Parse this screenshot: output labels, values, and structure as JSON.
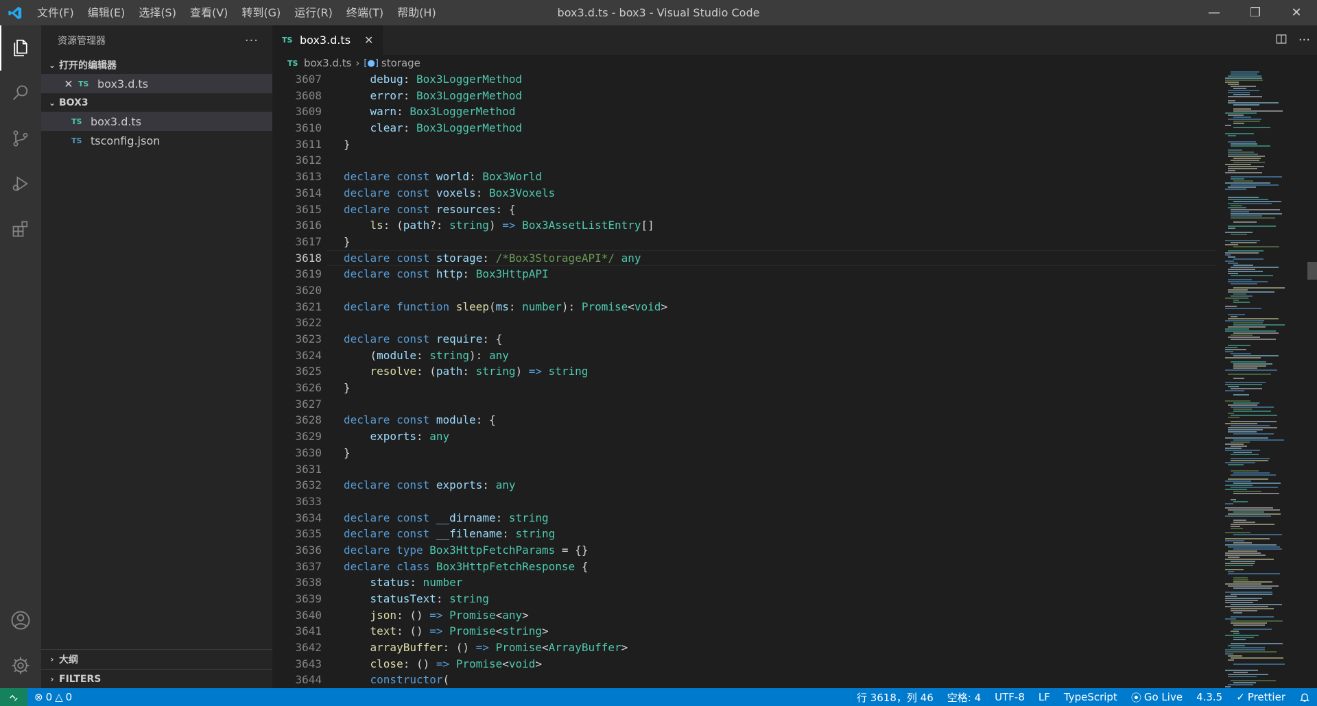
{
  "titlebar": {
    "title": "box3.d.ts - box3 - Visual Studio Code",
    "menu": [
      "文件(F)",
      "编辑(E)",
      "选择(S)",
      "查看(V)",
      "转到(G)",
      "运行(R)",
      "终端(T)",
      "帮助(H)"
    ],
    "controls": [
      "minimize-icon",
      "restore-icon",
      "close-icon"
    ]
  },
  "activitybar": {
    "items": [
      "explorer-icon",
      "search-icon",
      "source-control-icon",
      "run-debug-icon",
      "extensions-icon"
    ],
    "bottom": [
      "account-icon",
      "settings-gear-icon"
    ]
  },
  "sidebar": {
    "header": "资源管理器",
    "more": "···",
    "open_editors_label": "打开的编辑器",
    "open_editors": [
      {
        "badge": "TS",
        "name": "box3.d.ts"
      }
    ],
    "folder_label": "BOX3",
    "files": [
      {
        "badge": "TS",
        "name": "box3.d.ts"
      },
      {
        "badge": "TS",
        "name": "tsconfig.json"
      }
    ],
    "outline_label": "大纲",
    "filters_label": "FILTERS"
  },
  "editor": {
    "tab": {
      "badge": "TS",
      "name": "box3.d.ts",
      "close": "✕"
    },
    "breadcrumb": {
      "file_badge": "TS",
      "file": "box3.d.ts",
      "symbol": "storage"
    },
    "current_line": 3618
  },
  "code_lines": [
    {
      "n": "3607",
      "t": [
        [
          "id",
          "    debug"
        ],
        [
          "op",
          ": "
        ],
        [
          "ty",
          "Box3LoggerMethod"
        ]
      ]
    },
    {
      "n": "3608",
      "t": [
        [
          "id",
          "    error"
        ],
        [
          "op",
          ": "
        ],
        [
          "ty",
          "Box3LoggerMethod"
        ]
      ]
    },
    {
      "n": "3609",
      "t": [
        [
          "id",
          "    warn"
        ],
        [
          "op",
          ": "
        ],
        [
          "ty",
          "Box3LoggerMethod"
        ]
      ]
    },
    {
      "n": "3610",
      "t": [
        [
          "id",
          "    clear"
        ],
        [
          "op",
          ": "
        ],
        [
          "ty",
          "Box3LoggerMethod"
        ]
      ]
    },
    {
      "n": "3611",
      "t": [
        [
          "op",
          "}"
        ]
      ]
    },
    {
      "n": "3612",
      "t": []
    },
    {
      "n": "3613",
      "t": [
        [
          "kw",
          "declare"
        ],
        [
          "op",
          " "
        ],
        [
          "kw",
          "const"
        ],
        [
          "op",
          " "
        ],
        [
          "id",
          "world"
        ],
        [
          "op",
          ": "
        ],
        [
          "ty",
          "Box3World"
        ]
      ]
    },
    {
      "n": "3614",
      "t": [
        [
          "kw",
          "declare"
        ],
        [
          "op",
          " "
        ],
        [
          "kw",
          "const"
        ],
        [
          "op",
          " "
        ],
        [
          "id",
          "voxels"
        ],
        [
          "op",
          ": "
        ],
        [
          "ty",
          "Box3Voxels"
        ]
      ]
    },
    {
      "n": "3615",
      "t": [
        [
          "kw",
          "declare"
        ],
        [
          "op",
          " "
        ],
        [
          "kw",
          "const"
        ],
        [
          "op",
          " "
        ],
        [
          "id",
          "resources"
        ],
        [
          "op",
          ": {"
        ]
      ]
    },
    {
      "n": "3616",
      "t": [
        [
          "fn",
          "    ls"
        ],
        [
          "op",
          ": ("
        ],
        [
          "id",
          "path"
        ],
        [
          "op",
          "?: "
        ],
        [
          "ty",
          "string"
        ],
        [
          "op",
          ") "
        ],
        [
          "kw",
          "=>"
        ],
        [
          "op",
          " "
        ],
        [
          "ty",
          "Box3AssetListEntry"
        ],
        [
          "op",
          "[]"
        ]
      ]
    },
    {
      "n": "3617",
      "t": [
        [
          "op",
          "}"
        ]
      ]
    },
    {
      "n": "3618",
      "t": [
        [
          "kw",
          "declare"
        ],
        [
          "op",
          " "
        ],
        [
          "kw",
          "const"
        ],
        [
          "op",
          " "
        ],
        [
          "id",
          "storage"
        ],
        [
          "op",
          ": "
        ],
        [
          "cm",
          "/*Box3StorageAPI*/"
        ],
        [
          "op",
          " "
        ],
        [
          "ty",
          "any"
        ]
      ]
    },
    {
      "n": "3619",
      "t": [
        [
          "kw",
          "declare"
        ],
        [
          "op",
          " "
        ],
        [
          "kw",
          "const"
        ],
        [
          "op",
          " "
        ],
        [
          "id",
          "http"
        ],
        [
          "op",
          ": "
        ],
        [
          "ty",
          "Box3HttpAPI"
        ]
      ]
    },
    {
      "n": "3620",
      "t": []
    },
    {
      "n": "3621",
      "t": [
        [
          "kw",
          "declare"
        ],
        [
          "op",
          " "
        ],
        [
          "kw",
          "function"
        ],
        [
          "op",
          " "
        ],
        [
          "fn",
          "sleep"
        ],
        [
          "op",
          "("
        ],
        [
          "id",
          "ms"
        ],
        [
          "op",
          ": "
        ],
        [
          "ty",
          "number"
        ],
        [
          "op",
          "): "
        ],
        [
          "ty",
          "Promise"
        ],
        [
          "op",
          "<"
        ],
        [
          "ty",
          "void"
        ],
        [
          "op",
          ">"
        ]
      ]
    },
    {
      "n": "3622",
      "t": []
    },
    {
      "n": "3623",
      "t": [
        [
          "kw",
          "declare"
        ],
        [
          "op",
          " "
        ],
        [
          "kw",
          "const"
        ],
        [
          "op",
          " "
        ],
        [
          "id",
          "require"
        ],
        [
          "op",
          ": {"
        ]
      ]
    },
    {
      "n": "3624",
      "t": [
        [
          "op",
          "    ("
        ],
        [
          "id",
          "module"
        ],
        [
          "op",
          ": "
        ],
        [
          "ty",
          "string"
        ],
        [
          "op",
          "): "
        ],
        [
          "ty",
          "any"
        ]
      ]
    },
    {
      "n": "3625",
      "t": [
        [
          "fn",
          "    resolve"
        ],
        [
          "op",
          ": ("
        ],
        [
          "id",
          "path"
        ],
        [
          "op",
          ": "
        ],
        [
          "ty",
          "string"
        ],
        [
          "op",
          ") "
        ],
        [
          "kw",
          "=>"
        ],
        [
          "op",
          " "
        ],
        [
          "ty",
          "string"
        ]
      ]
    },
    {
      "n": "3626",
      "t": [
        [
          "op",
          "}"
        ]
      ]
    },
    {
      "n": "3627",
      "t": []
    },
    {
      "n": "3628",
      "t": [
        [
          "kw",
          "declare"
        ],
        [
          "op",
          " "
        ],
        [
          "kw",
          "const"
        ],
        [
          "op",
          " "
        ],
        [
          "id",
          "module"
        ],
        [
          "op",
          ": {"
        ]
      ]
    },
    {
      "n": "3629",
      "t": [
        [
          "id",
          "    exports"
        ],
        [
          "op",
          ": "
        ],
        [
          "ty",
          "any"
        ]
      ]
    },
    {
      "n": "3630",
      "t": [
        [
          "op",
          "}"
        ]
      ]
    },
    {
      "n": "3631",
      "t": []
    },
    {
      "n": "3632",
      "t": [
        [
          "kw",
          "declare"
        ],
        [
          "op",
          " "
        ],
        [
          "kw",
          "const"
        ],
        [
          "op",
          " "
        ],
        [
          "id",
          "exports"
        ],
        [
          "op",
          ": "
        ],
        [
          "ty",
          "any"
        ]
      ]
    },
    {
      "n": "3633",
      "t": []
    },
    {
      "n": "3634",
      "t": [
        [
          "kw",
          "declare"
        ],
        [
          "op",
          " "
        ],
        [
          "kw",
          "const"
        ],
        [
          "op",
          " "
        ],
        [
          "id",
          "__dirname"
        ],
        [
          "op",
          ": "
        ],
        [
          "ty",
          "string"
        ]
      ]
    },
    {
      "n": "3635",
      "t": [
        [
          "kw",
          "declare"
        ],
        [
          "op",
          " "
        ],
        [
          "kw",
          "const"
        ],
        [
          "op",
          " "
        ],
        [
          "id",
          "__filename"
        ],
        [
          "op",
          ": "
        ],
        [
          "ty",
          "string"
        ]
      ]
    },
    {
      "n": "3636",
      "t": [
        [
          "kw",
          "declare"
        ],
        [
          "op",
          " "
        ],
        [
          "kw",
          "type"
        ],
        [
          "op",
          " "
        ],
        [
          "ty",
          "Box3HttpFetchParams"
        ],
        [
          "op",
          " = {}"
        ]
      ]
    },
    {
      "n": "3637",
      "t": [
        [
          "kw",
          "declare"
        ],
        [
          "op",
          " "
        ],
        [
          "kw",
          "class"
        ],
        [
          "op",
          " "
        ],
        [
          "ty",
          "Box3HttpFetchResponse"
        ],
        [
          "op",
          " {"
        ]
      ]
    },
    {
      "n": "3638",
      "t": [
        [
          "id",
          "    status"
        ],
        [
          "op",
          ": "
        ],
        [
          "ty",
          "number"
        ]
      ]
    },
    {
      "n": "3639",
      "t": [
        [
          "id",
          "    statusText"
        ],
        [
          "op",
          ": "
        ],
        [
          "ty",
          "string"
        ]
      ]
    },
    {
      "n": "3640",
      "t": [
        [
          "fn",
          "    json"
        ],
        [
          "op",
          ": () "
        ],
        [
          "kw",
          "=>"
        ],
        [
          "op",
          " "
        ],
        [
          "ty",
          "Promise"
        ],
        [
          "op",
          "<"
        ],
        [
          "ty",
          "any"
        ],
        [
          "op",
          ">"
        ]
      ]
    },
    {
      "n": "3641",
      "t": [
        [
          "fn",
          "    text"
        ],
        [
          "op",
          ": () "
        ],
        [
          "kw",
          "=>"
        ],
        [
          "op",
          " "
        ],
        [
          "ty",
          "Promise"
        ],
        [
          "op",
          "<"
        ],
        [
          "ty",
          "string"
        ],
        [
          "op",
          ">"
        ]
      ]
    },
    {
      "n": "3642",
      "t": [
        [
          "fn",
          "    arrayBuffer"
        ],
        [
          "op",
          ": () "
        ],
        [
          "kw",
          "=>"
        ],
        [
          "op",
          " "
        ],
        [
          "ty",
          "Promise"
        ],
        [
          "op",
          "<"
        ],
        [
          "ty",
          "ArrayBuffer"
        ],
        [
          "op",
          ">"
        ]
      ]
    },
    {
      "n": "3643",
      "t": [
        [
          "fn",
          "    close"
        ],
        [
          "op",
          ": () "
        ],
        [
          "kw",
          "=>"
        ],
        [
          "op",
          " "
        ],
        [
          "ty",
          "Promise"
        ],
        [
          "op",
          "<"
        ],
        [
          "ty",
          "void"
        ],
        [
          "op",
          ">"
        ]
      ]
    },
    {
      "n": "3644",
      "t": [
        [
          "kw",
          "    constructor"
        ],
        [
          "op",
          "("
        ]
      ]
    }
  ],
  "statusbar": {
    "remote_icon": "remote-icon",
    "errors": "0",
    "warnings": "0",
    "position": "行 3618，列 46",
    "spaces": "空格: 4",
    "encoding": "UTF-8",
    "eol": "LF",
    "language": "TypeScript",
    "golive": "Go Live",
    "version": "4.3.5",
    "prettier": "Prettier",
    "bell_icon": "bell-icon"
  },
  "colors": {
    "statusbar": "#007acc",
    "remote": "#16825d",
    "keyword": "#569cd6",
    "type": "#4ec9b0",
    "function": "#dcdcaa",
    "identifier": "#9cdcfe",
    "comment": "#6a9955"
  }
}
